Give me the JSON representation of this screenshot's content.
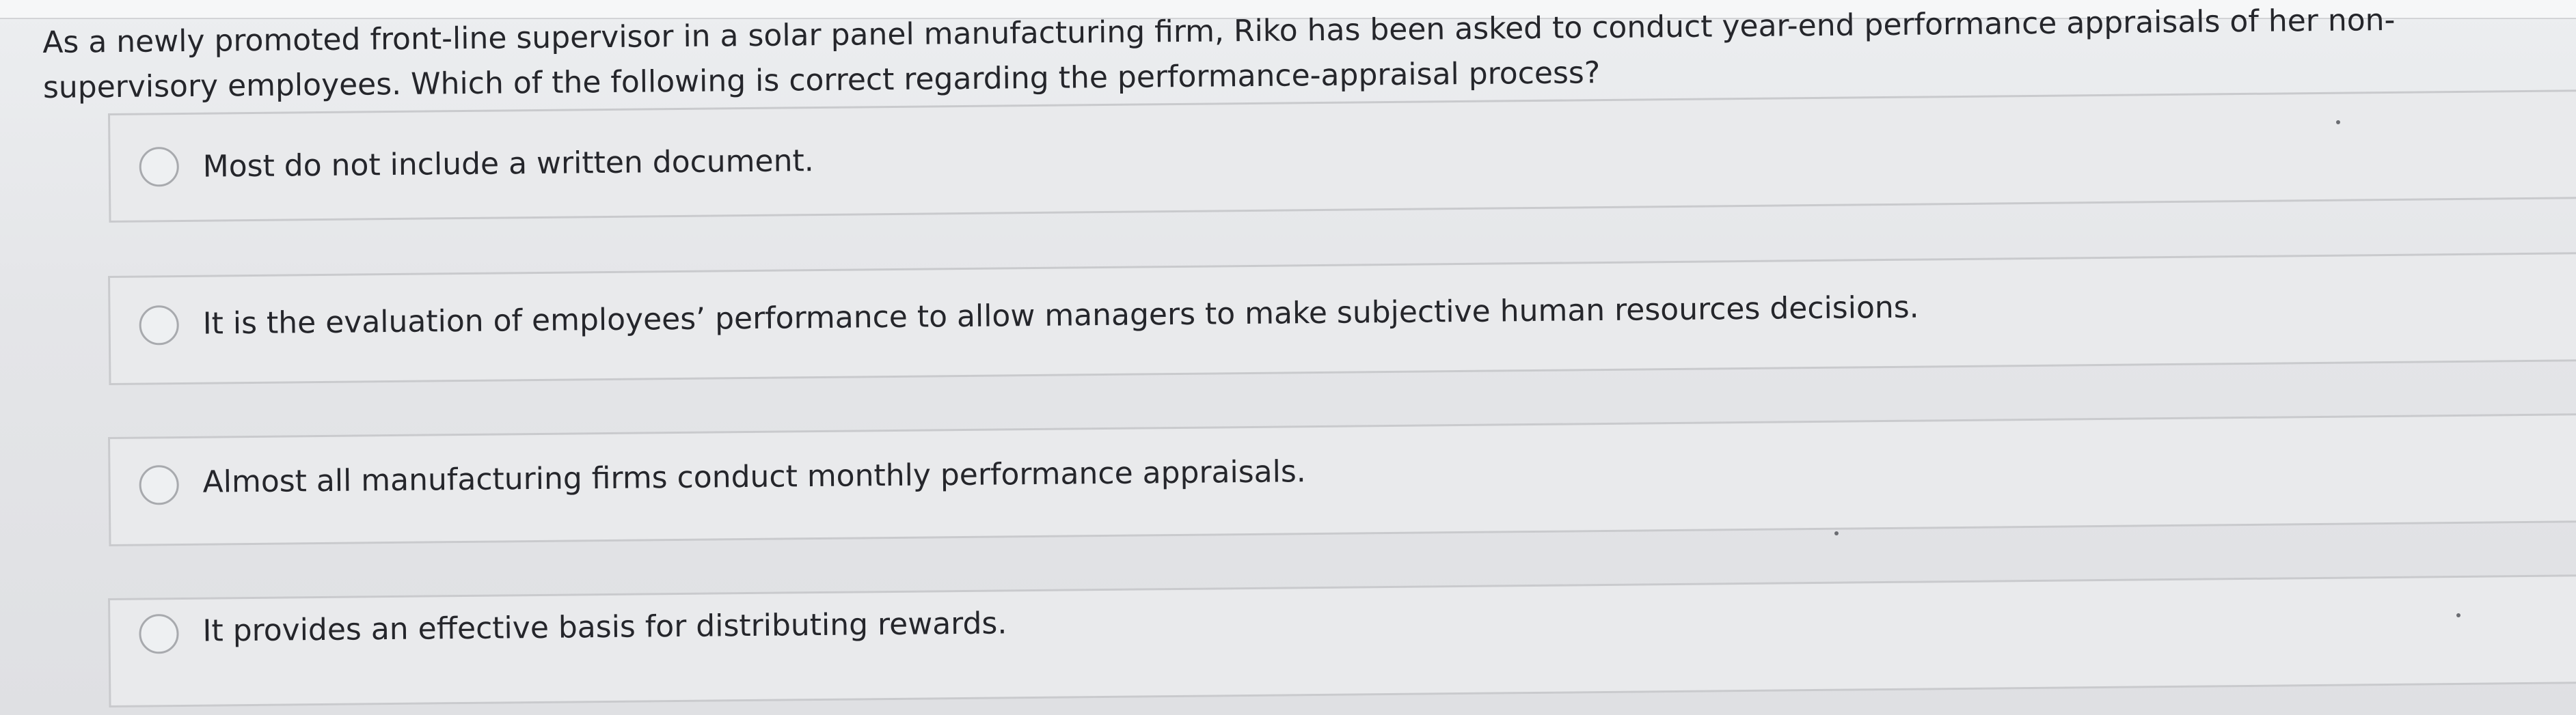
{
  "question": {
    "text": "As a newly promoted front-line supervisor in a solar panel manufacturing firm, Riko has been asked to conduct year-end performance appraisals of her non-supervisory employees. Which of the following is correct regarding the performance-appraisal process?"
  },
  "options": [
    {
      "label": "Most do not include a written document."
    },
    {
      "label": "It is the evaluation of employees’ performance to allow managers to make subjective human resources decisions."
    },
    {
      "label": "Almost all manufacturing firms conduct monthly performance appraisals."
    },
    {
      "label": "It provides an effective basis for distributing rewards."
    }
  ],
  "colors": {
    "background": "#e6e7e9",
    "text": "#25262b",
    "border": "#c9cacd",
    "radio_border": "#a8aaae"
  }
}
